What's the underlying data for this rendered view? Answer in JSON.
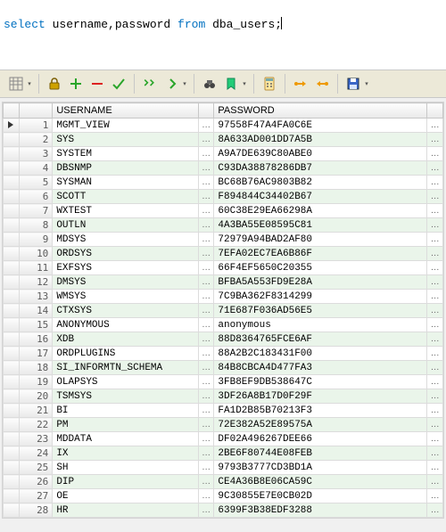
{
  "sql": {
    "kw1": "select",
    "mid": " username,password ",
    "kw2": "from",
    "rest": " dba_users;"
  },
  "toolbar": {
    "dropdown_glyph": "▾",
    "icons": {
      "grid_view": "grid-view-icon",
      "lock": "lock-icon",
      "add": "plus-icon",
      "remove": "minus-icon",
      "commit": "check-icon",
      "refresh_all": "refresh-double-icon",
      "refresh": "refresh-icon",
      "find": "binoculars-icon",
      "bookmark": "bookmark-icon",
      "calculator": "calculator-icon",
      "commit_tx": "tx-commit-icon",
      "rollback_tx": "tx-rollback-icon",
      "save": "save-icon"
    }
  },
  "grid": {
    "columns": {
      "username": "USERNAME",
      "password": "PASSWORD"
    },
    "ellipsis": "…",
    "current_row": 1,
    "rows": [
      {
        "n": 1,
        "user": "MGMT_VIEW",
        "pwd": "97558F47A4FA0C6E"
      },
      {
        "n": 2,
        "user": "SYS",
        "pwd": "8A633AD001DD7A5B"
      },
      {
        "n": 3,
        "user": "SYSTEM",
        "pwd": "A9A7DE639C80ABE0"
      },
      {
        "n": 4,
        "user": "DBSNMP",
        "pwd": "C93DA38878286DB7"
      },
      {
        "n": 5,
        "user": "SYSMAN",
        "pwd": "BC68B76AC9803B82"
      },
      {
        "n": 6,
        "user": "SCOTT",
        "pwd": "F894844C34402B67"
      },
      {
        "n": 7,
        "user": "WXTEST",
        "pwd": "60C38E29EA66298A"
      },
      {
        "n": 8,
        "user": "OUTLN",
        "pwd": "4A3BA55E08595C81"
      },
      {
        "n": 9,
        "user": "MDSYS",
        "pwd": "72979A94BAD2AF80"
      },
      {
        "n": 10,
        "user": "ORDSYS",
        "pwd": "7EFA02EC7EA6B86F"
      },
      {
        "n": 11,
        "user": "EXFSYS",
        "pwd": "66F4EF5650C20355"
      },
      {
        "n": 12,
        "user": "DMSYS",
        "pwd": "BFBA5A553FD9E28A"
      },
      {
        "n": 13,
        "user": "WMSYS",
        "pwd": "7C9BA362F8314299"
      },
      {
        "n": 14,
        "user": "CTXSYS",
        "pwd": "71E687F036AD56E5"
      },
      {
        "n": 15,
        "user": "ANONYMOUS",
        "pwd": "anonymous"
      },
      {
        "n": 16,
        "user": "XDB",
        "pwd": "88D8364765FCE6AF"
      },
      {
        "n": 17,
        "user": "ORDPLUGINS",
        "pwd": "88A2B2C183431F00"
      },
      {
        "n": 18,
        "user": "SI_INFORMTN_SCHEMA",
        "pwd": "84B8CBCA4D477FA3"
      },
      {
        "n": 19,
        "user": "OLAPSYS",
        "pwd": "3FB8EF9DB538647C"
      },
      {
        "n": 20,
        "user": "TSMSYS",
        "pwd": "3DF26A8B17D0F29F"
      },
      {
        "n": 21,
        "user": "BI",
        "pwd": "FA1D2B85B70213F3"
      },
      {
        "n": 22,
        "user": "PM",
        "pwd": "72E382A52E89575A"
      },
      {
        "n": 23,
        "user": "MDDATA",
        "pwd": "DF02A496267DEE66"
      },
      {
        "n": 24,
        "user": "IX",
        "pwd": "2BE6F80744E08FEB"
      },
      {
        "n": 25,
        "user": "SH",
        "pwd": "9793B3777CD3BD1A"
      },
      {
        "n": 26,
        "user": "DIP",
        "pwd": "CE4A36B8E06CA59C"
      },
      {
        "n": 27,
        "user": "OE",
        "pwd": "9C30855E7E0CB02D"
      },
      {
        "n": 28,
        "user": "HR",
        "pwd": "6399F3B38EDF3288"
      }
    ]
  }
}
